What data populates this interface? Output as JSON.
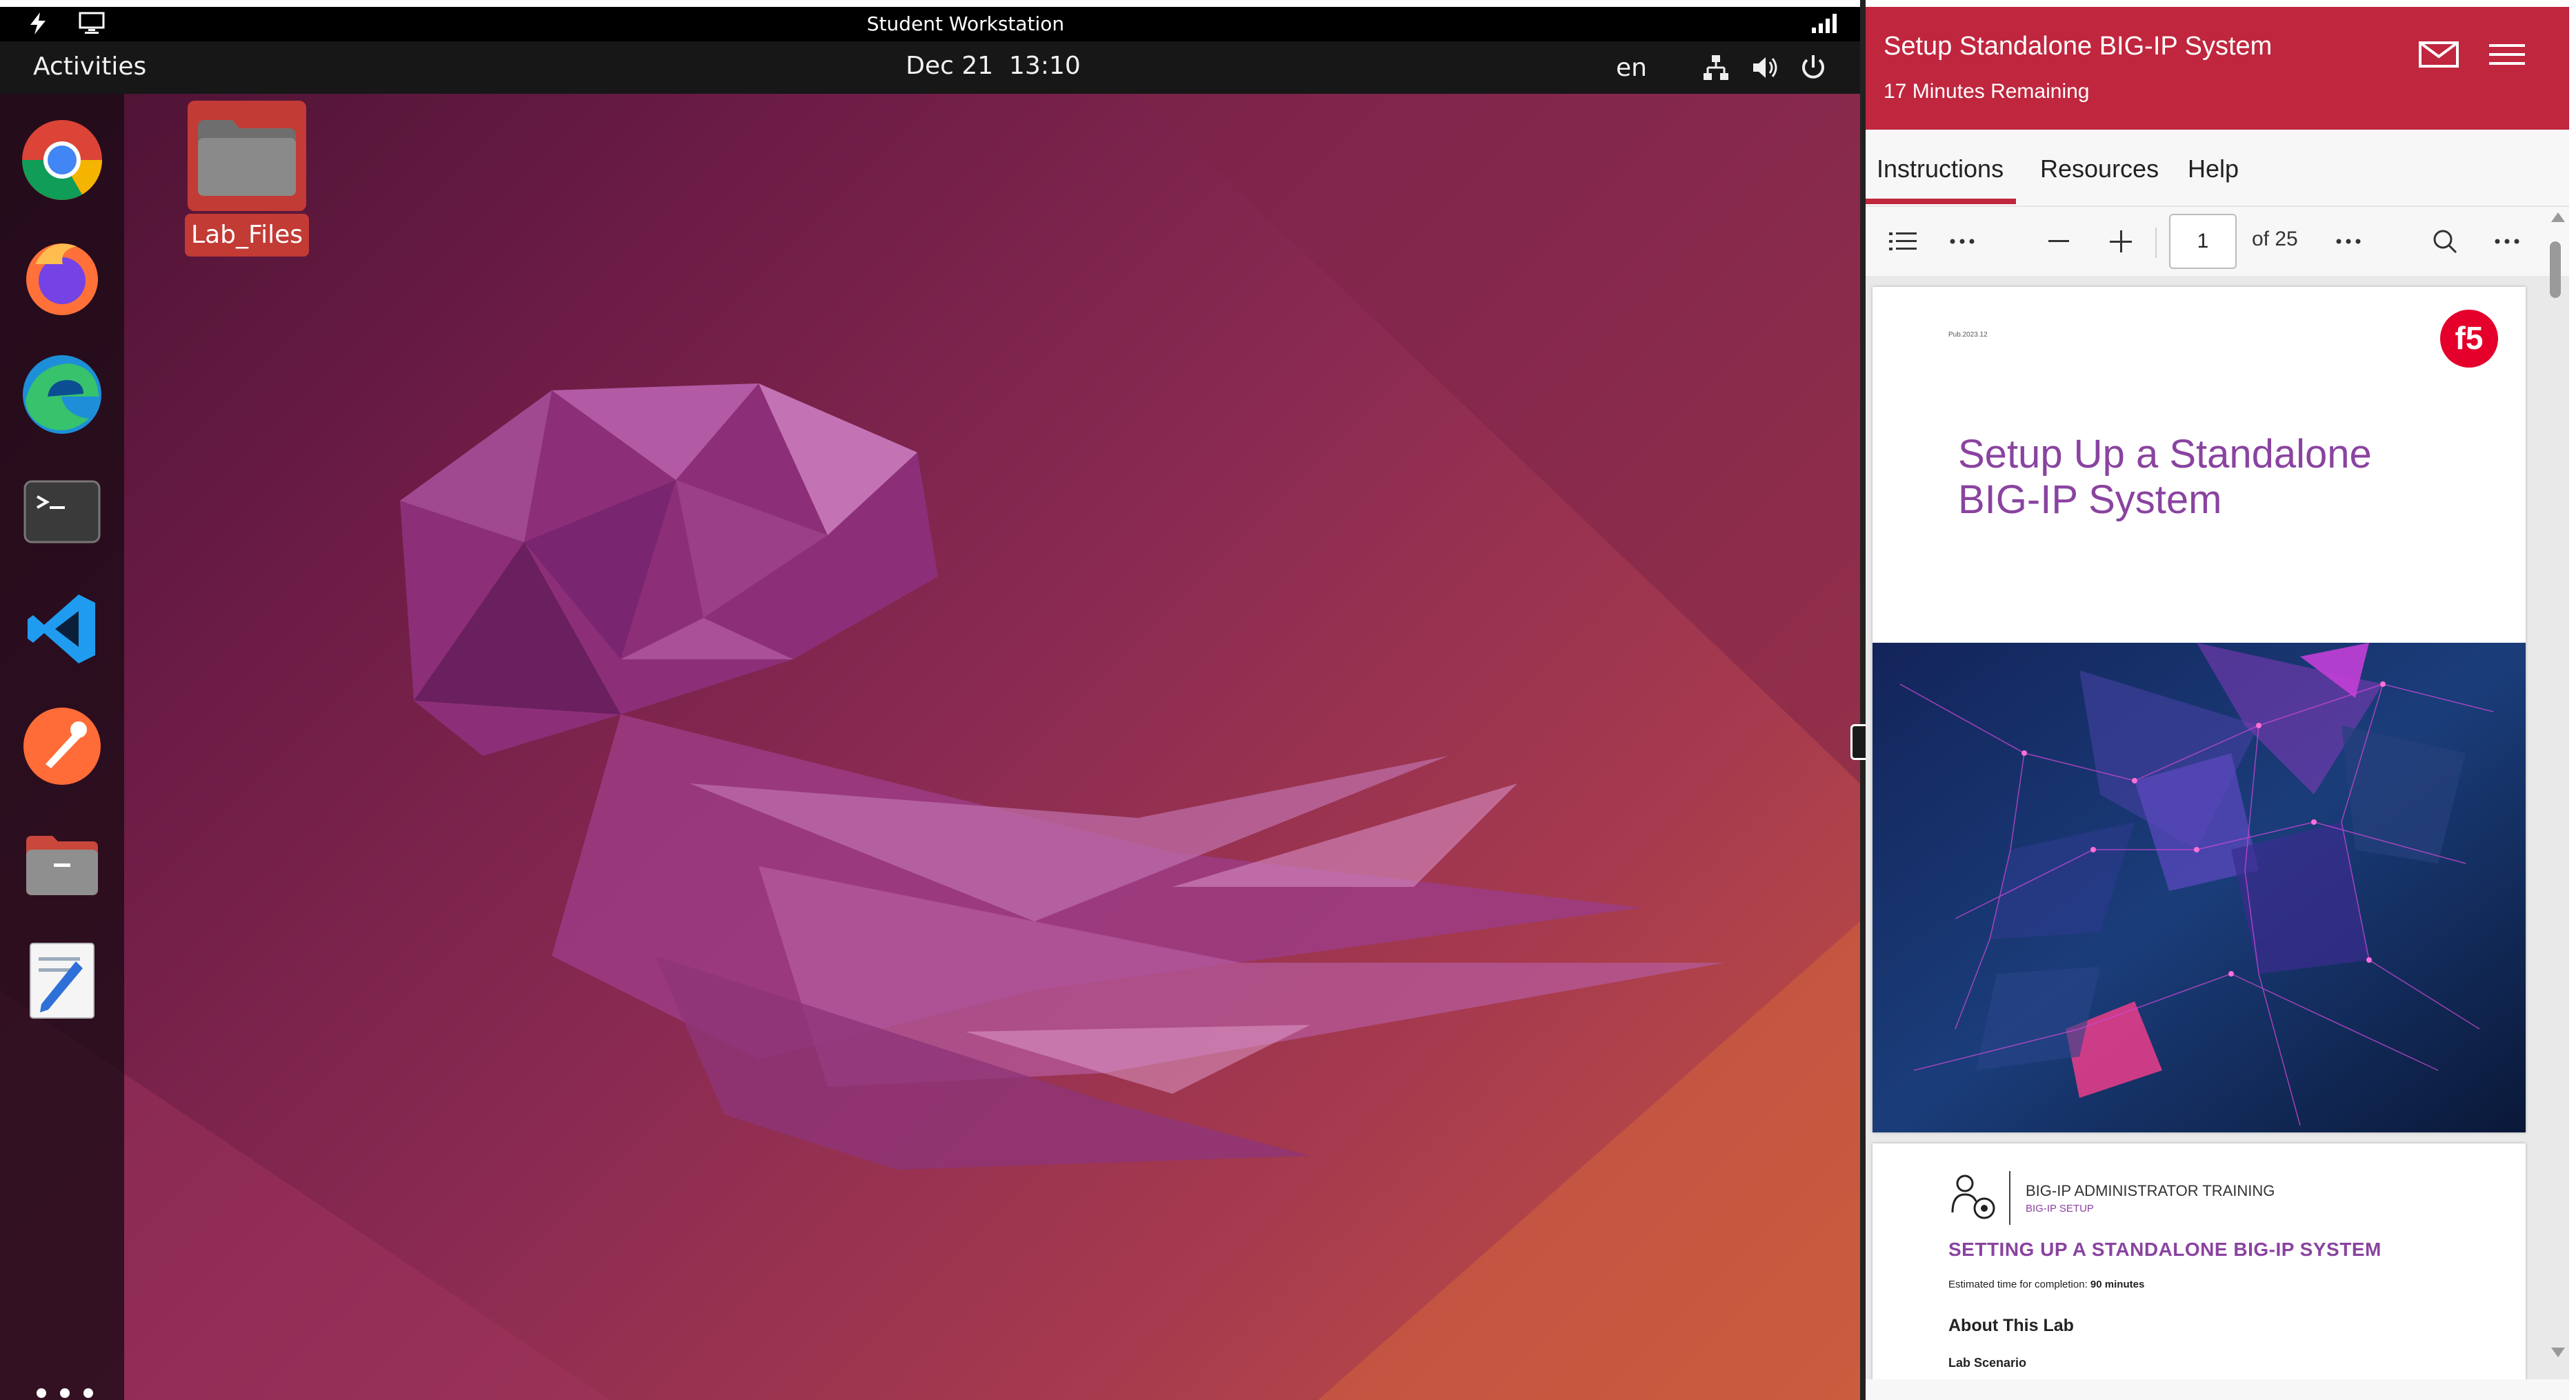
{
  "vm_bar": {
    "title": "Student Workstation"
  },
  "top_bar": {
    "activities_label": "Activities",
    "date": "Dec 21",
    "time": "13:10",
    "language": "en"
  },
  "dock": {
    "items": [
      {
        "name": "Chrome",
        "icon": "chrome-icon"
      },
      {
        "name": "Firefox",
        "icon": "firefox-icon"
      },
      {
        "name": "Edge",
        "icon": "edge-icon"
      },
      {
        "name": "Terminal",
        "icon": "terminal-icon"
      },
      {
        "name": "Visual Studio Code",
        "icon": "vscode-icon"
      },
      {
        "name": "Postman",
        "icon": "postman-icon"
      },
      {
        "name": "Files",
        "icon": "files-icon"
      },
      {
        "name": "Text Editor",
        "icon": "text-editor-icon"
      }
    ],
    "show_apps_icon": "apps-grid-icon"
  },
  "desktop": {
    "folder_label": "Lab_Files"
  },
  "lab_panel": {
    "title": "Setup Standalone BIG-IP System",
    "time_remaining": "17 Minutes Remaining",
    "tabs": [
      "Instructions",
      "Resources",
      "Help"
    ],
    "active_tab": "Instructions",
    "accent_color": "#c0263e"
  },
  "pdf_viewer": {
    "current_page": "1",
    "page_count_label": "of 25",
    "page1": {
      "publication_id": "Pub.2023.12",
      "title_line1": "Setup Up a Standalone",
      "title_line2": "BIG-IP System",
      "title_color": "#8a43a0"
    },
    "page2": {
      "course": "BIG-IP ADMINISTRATOR TRAINING",
      "module": "BIG-IP SETUP",
      "heading": "SETTING UP A STANDALONE BIG-IP SYSTEM",
      "estimated_time_label": "Estimated time for completion:",
      "estimated_time_value": "90 minutes",
      "section_heading": "About This Lab",
      "subsection_heading": "Lab Scenario"
    }
  }
}
